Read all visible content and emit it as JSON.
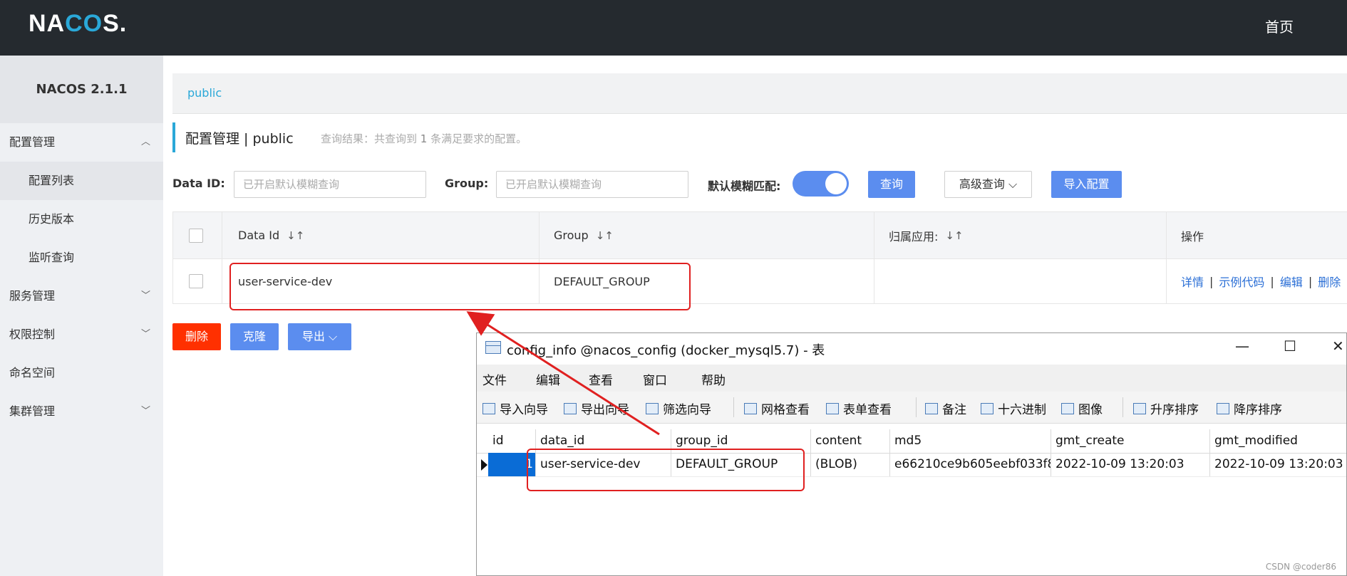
{
  "header": {
    "logo": "NACOS.",
    "logo_parts": [
      "NA",
      "CO",
      "S."
    ],
    "home": "首页"
  },
  "sidebar": {
    "version": "NACOS 2.1.1",
    "items": [
      {
        "label": "配置管理",
        "expanded": true
      },
      {
        "label": "配置列表",
        "sub": true,
        "active": true
      },
      {
        "label": "历史版本",
        "sub": true
      },
      {
        "label": "监听查询",
        "sub": true
      },
      {
        "label": "服务管理"
      },
      {
        "label": "权限控制"
      },
      {
        "label": "命名空间"
      },
      {
        "label": "集群管理"
      }
    ]
  },
  "breadcrumb": {
    "namespace": "public"
  },
  "title": {
    "text": "配置管理 | public",
    "note_prefix": "查询结果：共查询到",
    "count": "1",
    "note_suffix": "条满足要求的配置。"
  },
  "search": {
    "dataid_label": "Data ID:",
    "dataid_placeholder": "已开启默认模糊查询",
    "group_label": "Group:",
    "group_placeholder": "已开启默认模糊查询",
    "fuzzy_label": "默认模糊匹配:",
    "fuzzy_on": true,
    "query_btn": "查询",
    "advanced_btn": "高级查询",
    "import_btn": "导入配置"
  },
  "table": {
    "headers": [
      "Data Id",
      "Group",
      "归属应用:",
      "操作"
    ],
    "rows": [
      {
        "data_id": "user-service-dev",
        "group": "DEFAULT_GROUP",
        "app": "",
        "ops": [
          "详情",
          "示例代码",
          "编辑",
          "删除"
        ]
      }
    ]
  },
  "actions": {
    "delete": "删除",
    "clone": "克隆",
    "export": "导出"
  },
  "db_window": {
    "title": "config_info @nacos_config (docker_mysql5.7) - 表",
    "menu": [
      "文件",
      "编辑",
      "查看",
      "窗口",
      "帮助"
    ],
    "tools": [
      "导入向导",
      "导出向导",
      "筛选向导",
      "网格查看",
      "表单查看",
      "备注",
      "十六进制",
      "图像",
      "升序排序",
      "降序排序"
    ],
    "columns": [
      "id",
      "data_id",
      "group_id",
      "content",
      "md5",
      "gmt_create",
      "gmt_modified"
    ],
    "row": [
      "1",
      "user-service-dev",
      "DEFAULT_GROUP",
      "(BLOB)",
      "e66210ce9b605eebf033f8",
      "2022-10-09 13:20:03",
      "2022-10-09 13:20:03"
    ]
  },
  "watermark": "CSDN @coder86",
  "colors": {
    "accent": "#2aa8d8",
    "primary": "#5b8def",
    "danger": "#ff3000",
    "annotation": "#e02020"
  }
}
